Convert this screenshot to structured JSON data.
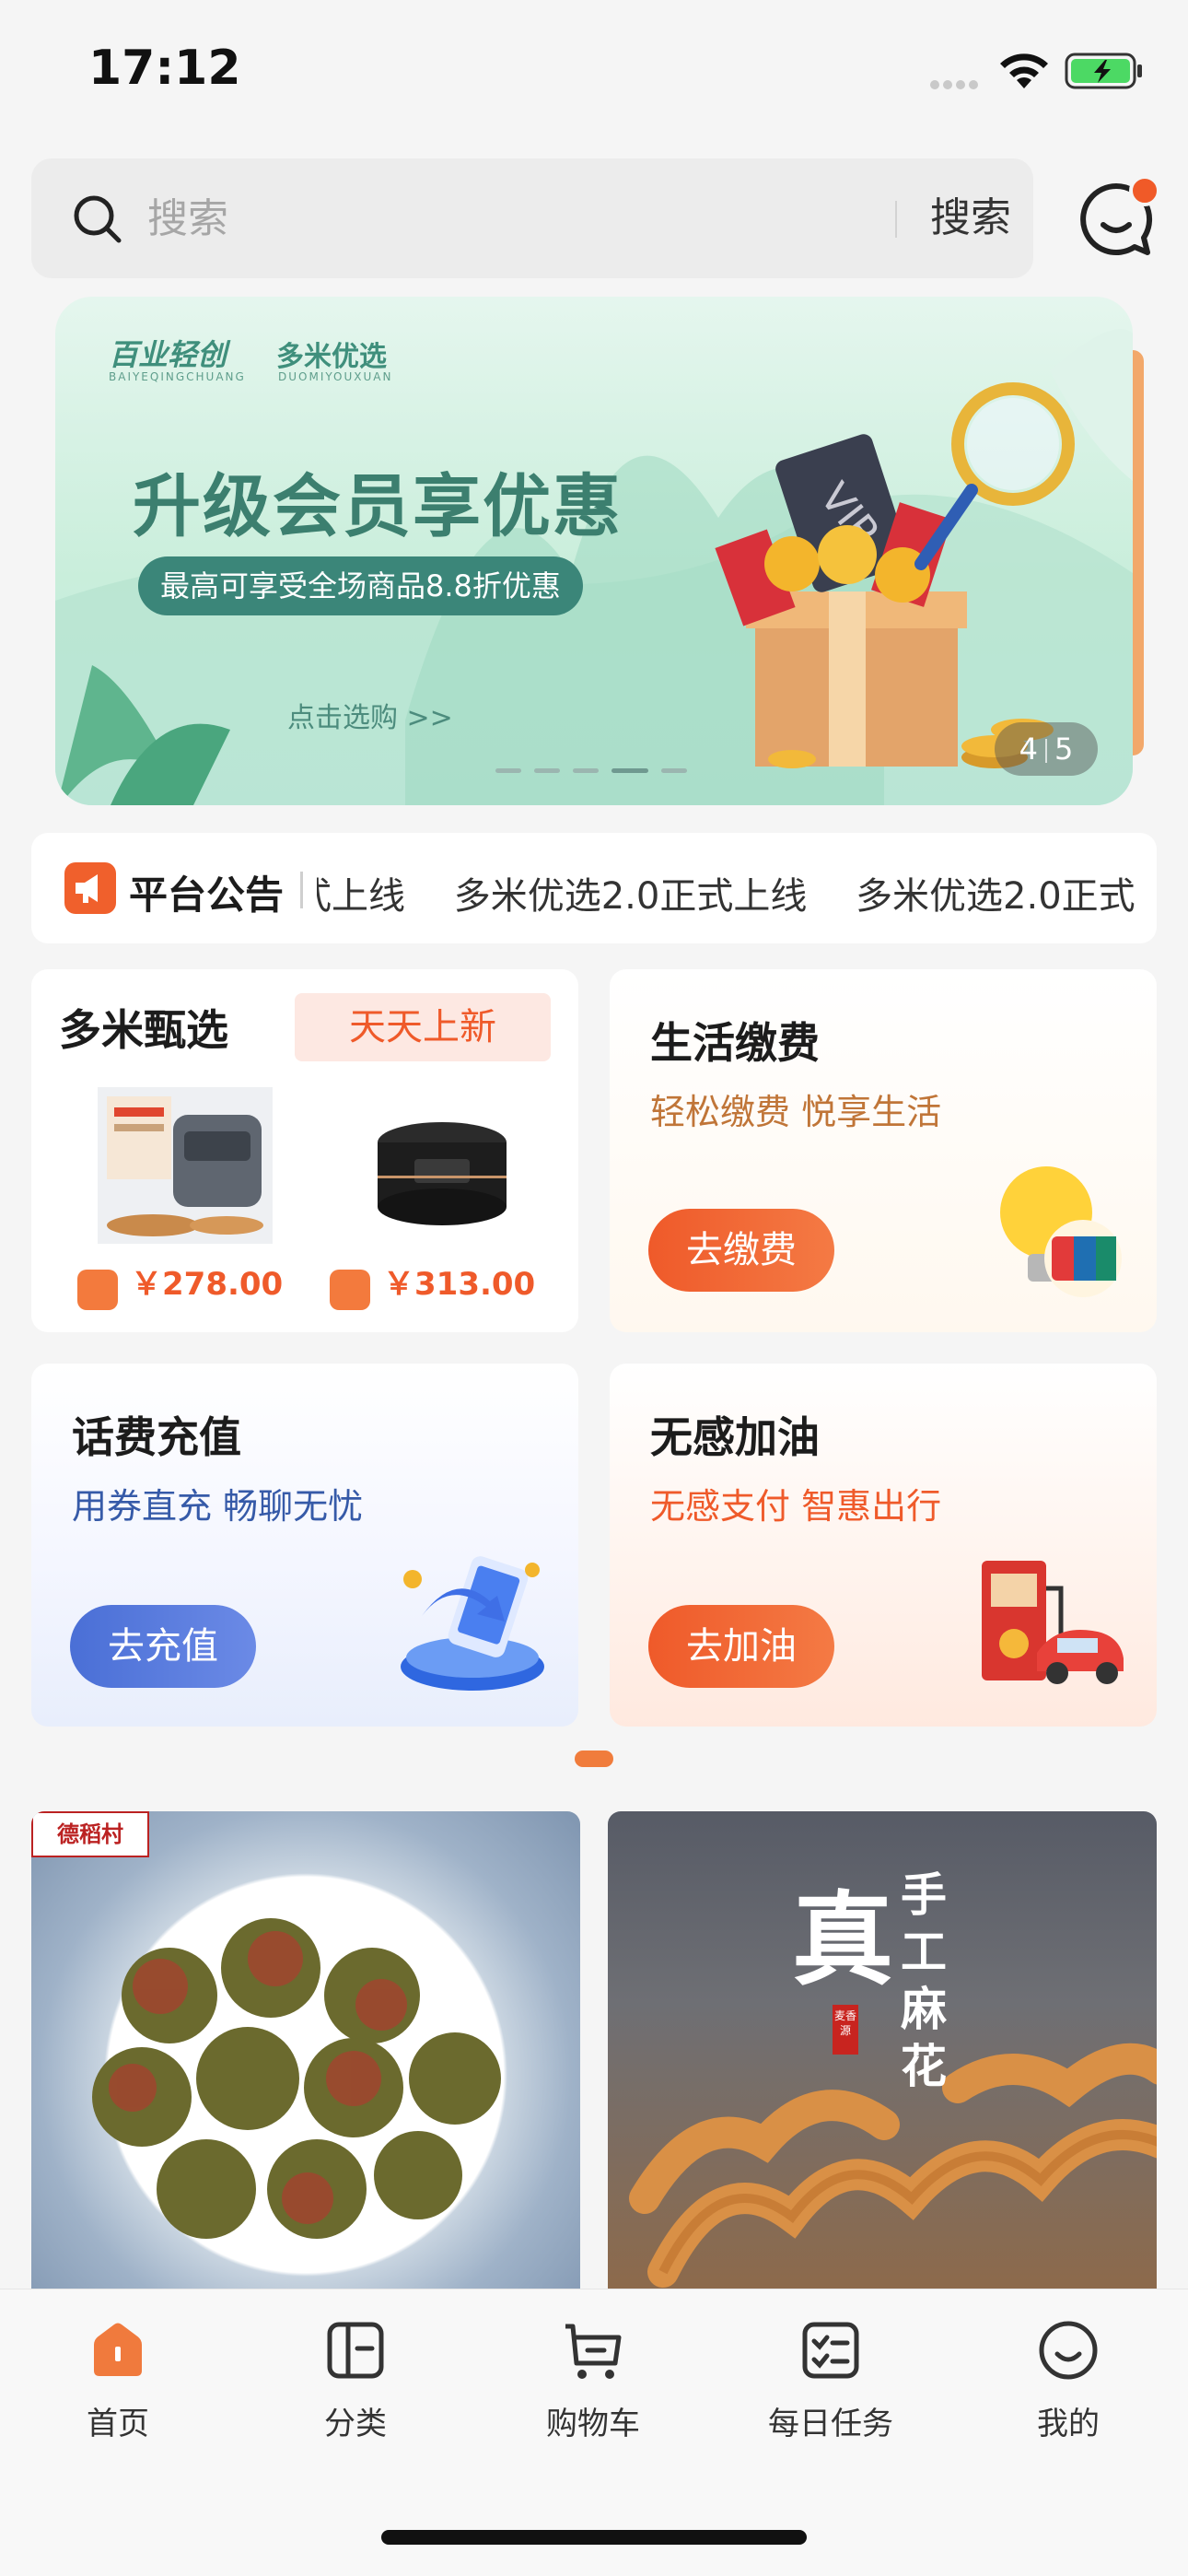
{
  "status_bar": {
    "time": "17:12"
  },
  "search": {
    "placeholder": "搜索",
    "button_label": "搜索"
  },
  "banner": {
    "brand_left": "百业轻创",
    "brand_left_sub": "BAIYEQINGCHUANG",
    "brand_right": "多米优选",
    "brand_right_sub": "DUOMIYOUXUAN",
    "headline": "升级会员享优惠",
    "pill_text": "最高可享受全场商品8.8折优惠",
    "link_text": "点击选购 >>",
    "vip_text": "VIP",
    "page_current": "4",
    "page_total": "5"
  },
  "notice": {
    "title": "平台公告",
    "items": [
      "式上线",
      "多米优选2.0正式上线",
      "多米优选2.0正式"
    ]
  },
  "cards": {
    "selection": {
      "title": "多米甄选",
      "tag": "天天上新",
      "products": [
        {
          "price": "￥278.00"
        },
        {
          "price": "￥313.00"
        }
      ]
    },
    "bills": {
      "title": "生活缴费",
      "subtitle": "轻松缴费 悦享生活",
      "cta": "去缴费"
    },
    "phone": {
      "title": "话费充值",
      "subtitle": "用券直充   畅聊无忧",
      "cta": "去充值"
    },
    "fuel": {
      "title": "无感加油",
      "subtitle": "无感支付  智惠出行",
      "cta": "去加油"
    }
  },
  "tiles": [
    {
      "logo": "德稻村"
    },
    {
      "big_char": "真",
      "side_text": "手工麻花",
      "seal": "麦香源"
    }
  ],
  "tabbar": {
    "items": [
      {
        "label": "首页",
        "icon": "home-icon",
        "active": true
      },
      {
        "label": "分类",
        "icon": "category-icon",
        "active": false
      },
      {
        "label": "购物车",
        "icon": "cart-icon",
        "active": false
      },
      {
        "label": "每日任务",
        "icon": "task-icon",
        "active": false
      },
      {
        "label": "我的",
        "icon": "profile-icon",
        "active": false
      }
    ]
  },
  "colors": {
    "accent": "#ef5a2a",
    "blue": "#4a6fd6",
    "teal": "#3b8679"
  }
}
